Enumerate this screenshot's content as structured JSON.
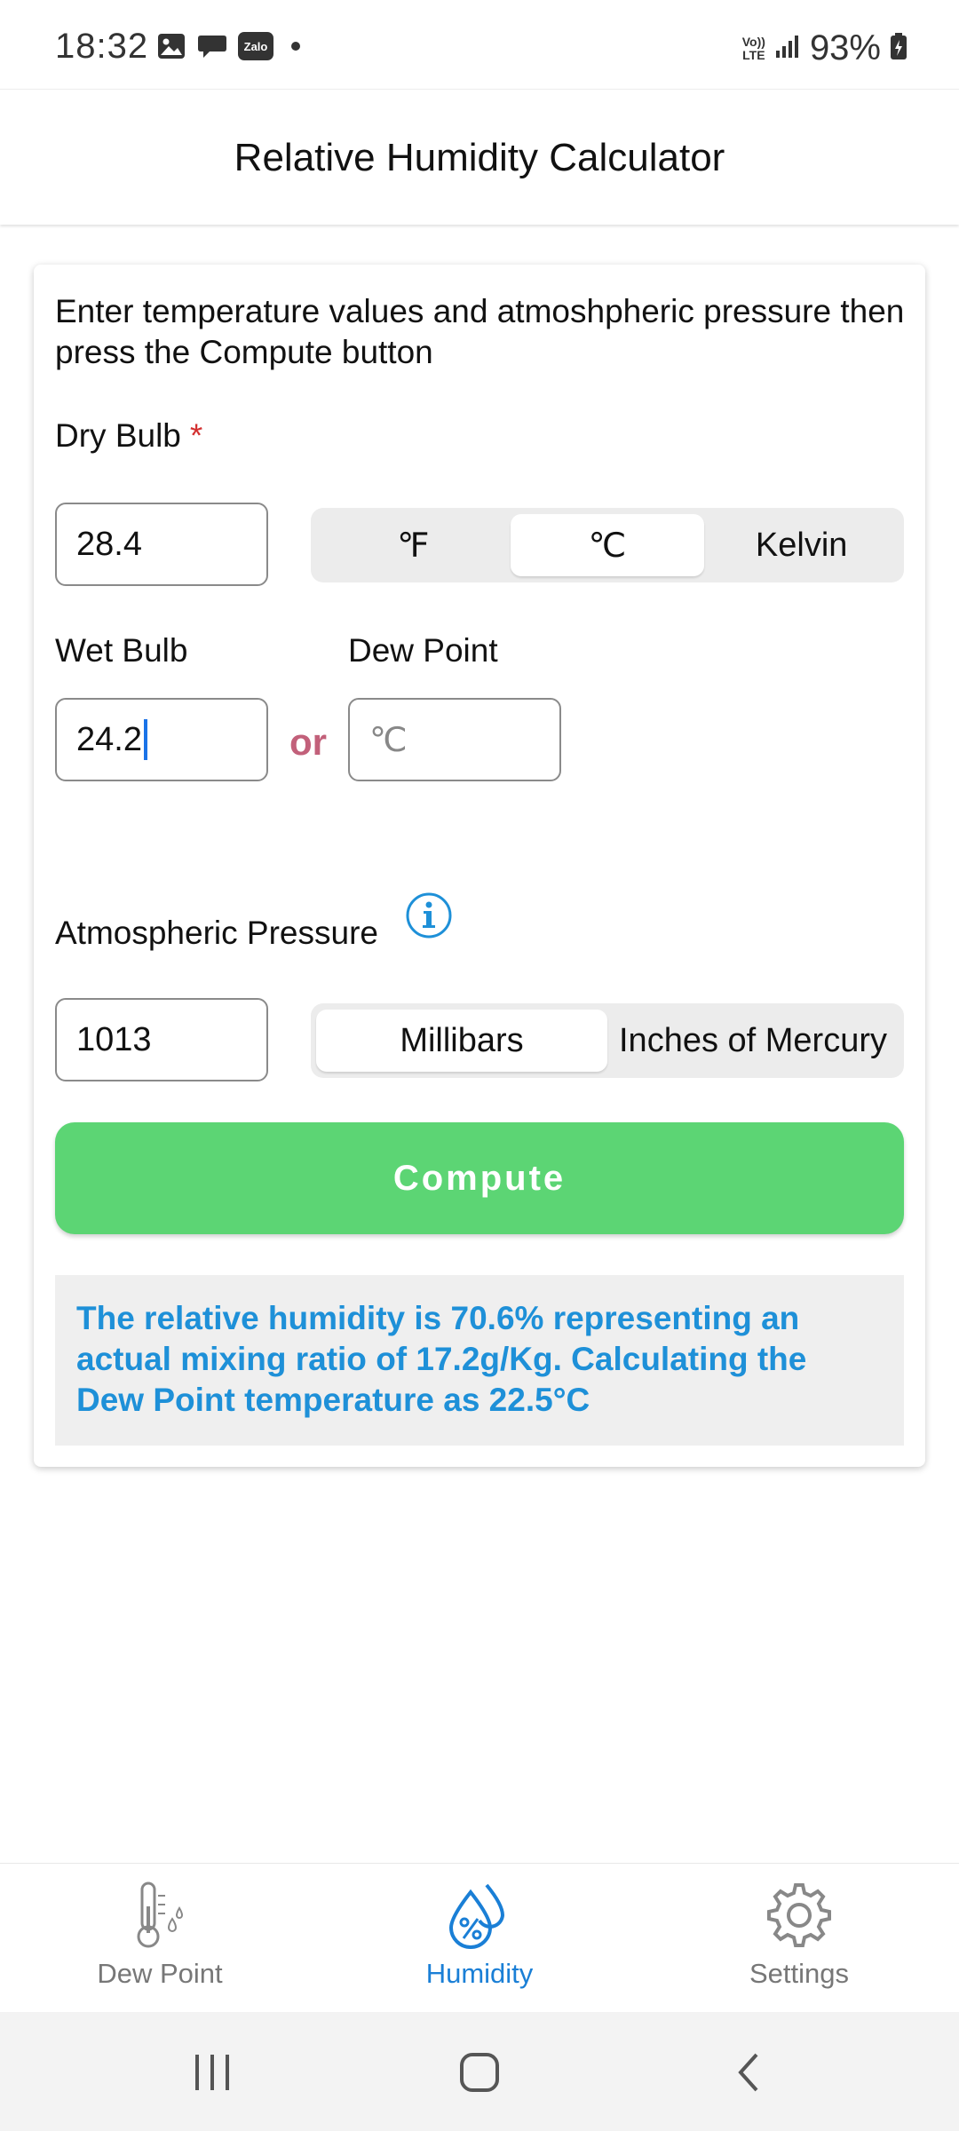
{
  "status_bar": {
    "time": "18:32",
    "icons": [
      "gallery-icon",
      "chat-icon",
      "zalo-icon",
      "dot-icon"
    ],
    "zalo_text": "Zalo",
    "network": "Vo)) LTE",
    "battery": "93%"
  },
  "header": {
    "title": "Relative Humidity Calculator"
  },
  "form": {
    "instructions": "Enter temperature values and atmoshpheric pressure then press the Compute button",
    "dry_bulb": {
      "label": "Dry Bulb",
      "required_mark": "*",
      "value": "28.4",
      "units": [
        "℉",
        "℃",
        "Kelvin"
      ],
      "selected_unit": "℃"
    },
    "wet_bulb": {
      "label": "Wet Bulb",
      "value": "24.2"
    },
    "or_text": "or",
    "dew_point": {
      "label": "Dew Point",
      "value": "",
      "placeholder": "℃"
    },
    "pressure": {
      "label": "Atmospheric Pressure",
      "value": "1013",
      "units": [
        "Millibars",
        "Inches of Mercury"
      ],
      "selected_unit": "Millibars"
    },
    "compute_label": "Compute",
    "result": "The relative humidity is 70.6% representing an actual mixing ratio of 17.2g/Kg. Calculating the Dew Point temperature as 22.5°C"
  },
  "bottom_nav": {
    "items": [
      {
        "label": "Dew Point",
        "icon": "thermometer-icon",
        "active": false
      },
      {
        "label": "Humidity",
        "icon": "humidity-drops-icon",
        "active": true
      },
      {
        "label": "Settings",
        "icon": "gear-icon",
        "active": false
      }
    ]
  },
  "colors": {
    "compute": "#5cd574",
    "result_text": "#1e90d8",
    "active_tab": "#1a7fd6",
    "or_text": "#c2607a",
    "required": "#d32f2f"
  }
}
